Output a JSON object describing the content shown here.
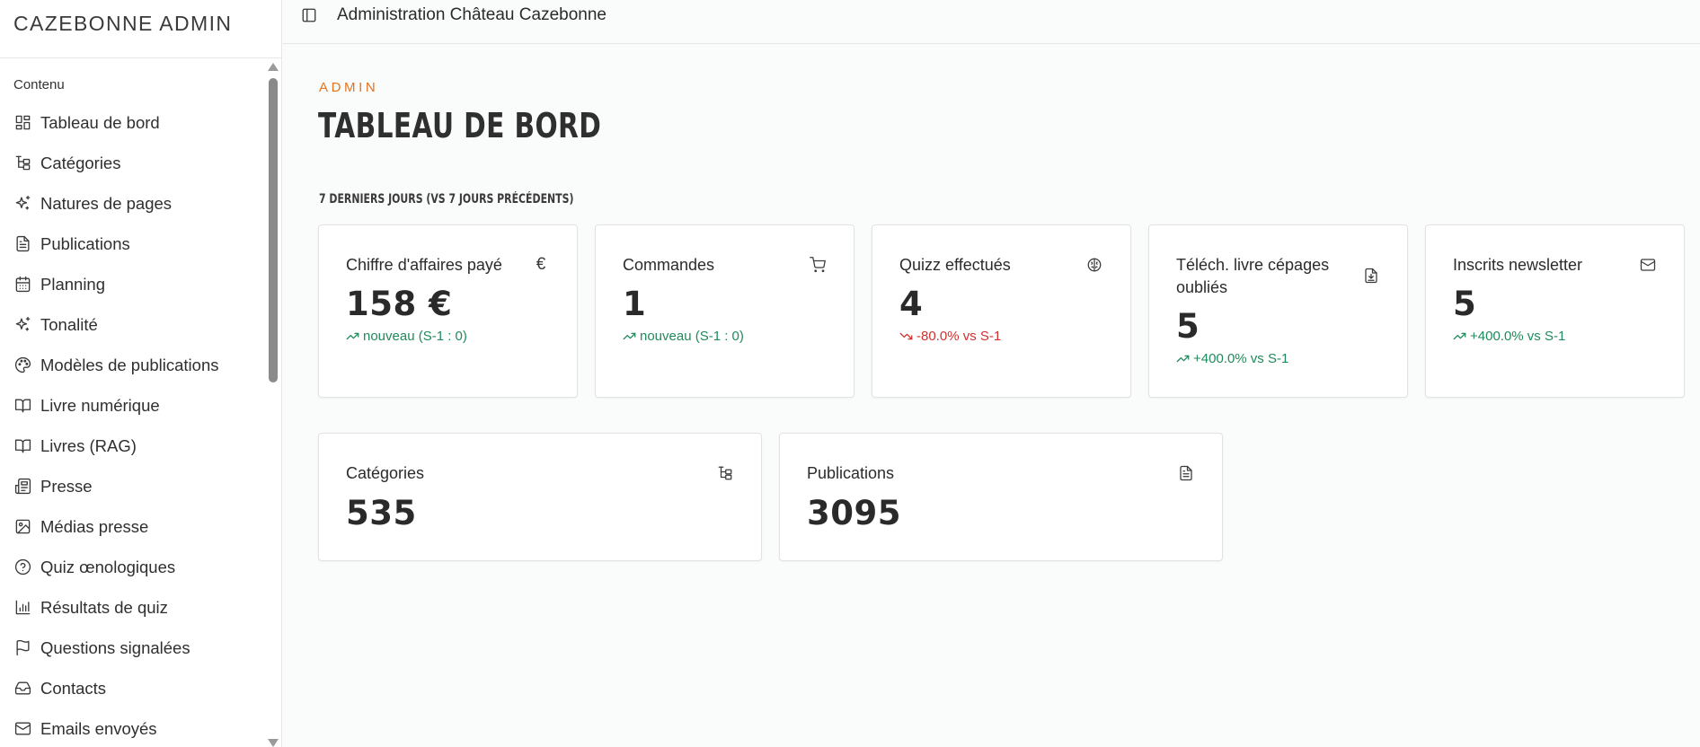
{
  "sidebar": {
    "brand": "CAZEBONNE ADMIN",
    "section": "Contenu",
    "items": [
      {
        "label": "Tableau de bord",
        "icon": "dashboard-icon"
      },
      {
        "label": "Catégories",
        "icon": "tree-icon"
      },
      {
        "label": "Natures de pages",
        "icon": "sparkles-icon"
      },
      {
        "label": "Publications",
        "icon": "document-icon"
      },
      {
        "label": "Planning",
        "icon": "calendar-icon"
      },
      {
        "label": "Tonalité",
        "icon": "sparkles-icon"
      },
      {
        "label": "Modèles de publications",
        "icon": "palette-icon"
      },
      {
        "label": "Livre numérique",
        "icon": "book-open-icon"
      },
      {
        "label": "Livres (RAG)",
        "icon": "book-open-icon"
      },
      {
        "label": "Presse",
        "icon": "newspaper-icon"
      },
      {
        "label": "Médias presse",
        "icon": "image-icon"
      },
      {
        "label": "Quiz œnologiques",
        "icon": "help-circle-icon"
      },
      {
        "label": "Résultats de quiz",
        "icon": "bar-chart-icon"
      },
      {
        "label": "Questions signalées",
        "icon": "flag-icon"
      },
      {
        "label": "Contacts",
        "icon": "inbox-icon"
      },
      {
        "label": "Emails envoyés",
        "icon": "mail-icon"
      }
    ]
  },
  "topbar": {
    "title": "Administration Château Cazebonne"
  },
  "main": {
    "eyebrow": "ADMIN",
    "title": "TABLEAU DE BORD",
    "section_label": "7 DERNIERS JOURS (VS 7 JOURS PRÉCÉDENTS)",
    "stats": [
      {
        "title": "Chiffre d'affaires payé",
        "value": "158 €",
        "delta": "nouveau (S-1 : 0)",
        "trend": "up",
        "icon": "euro-icon"
      },
      {
        "title": "Commandes",
        "value": "1",
        "delta": "nouveau (S-1 : 0)",
        "trend": "up",
        "icon": "cart-icon"
      },
      {
        "title": "Quizz effectués",
        "value": "4",
        "delta": "-80.0% vs S-1",
        "trend": "down",
        "icon": "brain-icon"
      },
      {
        "title": "Téléch. livre cépages oubliés",
        "value": "5",
        "delta": "+400.0% vs S-1",
        "trend": "up",
        "icon": "download-file-icon"
      },
      {
        "title": "Inscrits newsletter",
        "value": "5",
        "delta": "+400.0% vs S-1",
        "trend": "up",
        "icon": "mail-icon"
      }
    ],
    "totals": [
      {
        "title": "Catégories",
        "value": "535",
        "icon": "tree-icon"
      },
      {
        "title": "Publications",
        "value": "3095",
        "icon": "document-icon"
      }
    ]
  },
  "colors": {
    "accent": "#e4741f",
    "up": "#1f8a5c",
    "down": "#d0312d"
  }
}
